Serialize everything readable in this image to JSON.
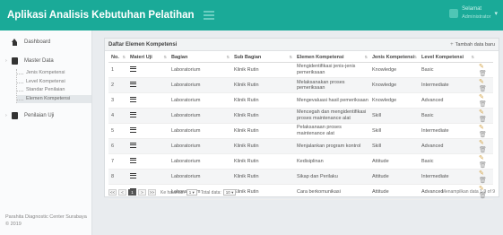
{
  "header": {
    "app_title": "Aplikasi Analisis Kebutuhan Pelatihan",
    "user_greeting": "Selamat",
    "user_name": "Administrator"
  },
  "sidebar": {
    "dashboard": "Dashboard",
    "master_data": "Master Data",
    "sub_items": [
      "Jenis Kompetensi",
      "Level Kompetensi",
      "Standar Penilaian",
      "Elemen Kompetensi"
    ],
    "penilaian": "Penilaian Uji",
    "footer_line1": "Parahita Diagnostic Center Surabaya",
    "footer_line2": "© 2019"
  },
  "panel": {
    "title": "Daftar Elemen Kompetensi",
    "add_button": "Tambah data baru"
  },
  "table": {
    "headers": [
      "No.",
      "Materi Uji",
      "Bagian",
      "Sub Bagian",
      "Elemen Kompetensi",
      "Jenis Kompetensi",
      "Level Kompetensi",
      ""
    ],
    "rows": [
      {
        "no": "1",
        "bagian": "Laboratorium",
        "sub": "Klinik Rutin",
        "elemen": "Mengidentifikasi jenis-jenis pemeriksaan",
        "jenis": "Knowledge",
        "level": "Basic"
      },
      {
        "no": "2",
        "bagian": "Laboratorium",
        "sub": "Klinik Rutin",
        "elemen": "Melaksanakan proses pemeriksaan",
        "jenis": "Knowledge",
        "level": "Intermediate"
      },
      {
        "no": "3",
        "bagian": "Laboratorium",
        "sub": "Klinik Rutin",
        "elemen": "Mengevaluasi hasil pemeriksaan",
        "jenis": "Knowledge",
        "level": "Advanced"
      },
      {
        "no": "4",
        "bagian": "Laboratorium",
        "sub": "Klinik Rutin",
        "elemen": "Mencegah dan mengidentifikasi proses maintenance alat",
        "jenis": "Skill",
        "level": "Basic"
      },
      {
        "no": "5",
        "bagian": "Laboratorium",
        "sub": "Klinik Rutin",
        "elemen": "Pelaksanaan proses maintenance alat",
        "jenis": "Skill",
        "level": "Intermediate"
      },
      {
        "no": "6",
        "bagian": "Laboratorium",
        "sub": "Klinik Rutin",
        "elemen": "Menjalankan program kontrol",
        "jenis": "Skill",
        "level": "Advanced"
      },
      {
        "no": "7",
        "bagian": "Laboratorium",
        "sub": "Klinik Rutin",
        "elemen": "Kedisiplinan",
        "jenis": "Attitude",
        "level": "Basic"
      },
      {
        "no": "8",
        "bagian": "Laboratorium",
        "sub": "Klinik Rutin",
        "elemen": "Sikap dan Perilaku",
        "jenis": "Attitude",
        "level": "Intermediate"
      },
      {
        "no": "9",
        "bagian": "Laboratorium",
        "sub": "Klinik Rutin",
        "elemen": "Cara berkomunikasi",
        "jenis": "Attitude",
        "level": "Advanced"
      }
    ]
  },
  "pager": {
    "first": "<<",
    "prev": "<",
    "current": "1",
    "next": ">",
    "last": ">>",
    "page_label": "Ke halaman",
    "page_value": "1",
    "total_label": "Total data:",
    "total_value": "10",
    "info": "Menampilkan data 1-9 of 9"
  }
}
